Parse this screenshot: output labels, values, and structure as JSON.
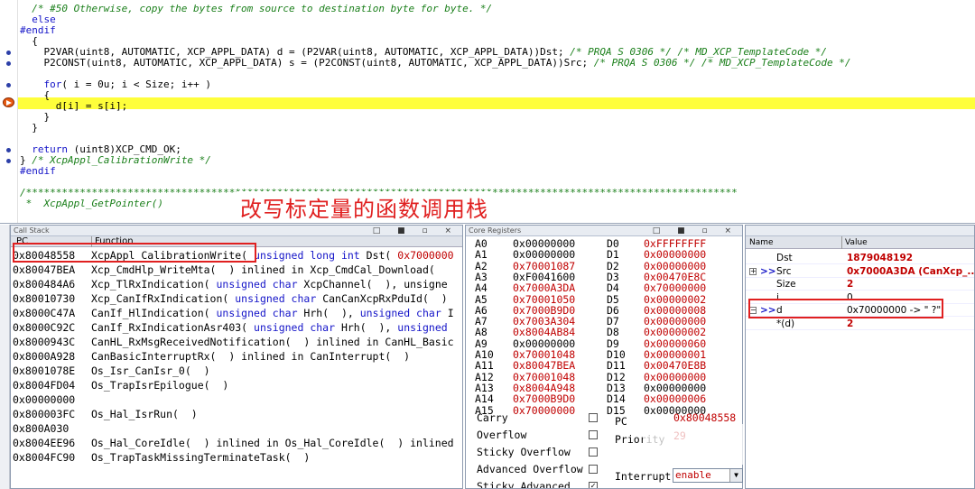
{
  "editor": {
    "lines": [
      {
        "text": "  /* #50 Otherwise, copy the bytes from source to destination byte for byte. */",
        "cls": "cmt"
      },
      {
        "text": "  else",
        "cls": "pp"
      },
      {
        "text": "#endif",
        "cls": "pp"
      },
      {
        "text": "  {",
        "cls": ""
      },
      {
        "text": "    P2VAR(uint8, AUTOMATIC, XCP_APPL_DATA) d = (P2VAR(uint8, AUTOMATIC, XCP_APPL_DATA))Dst; /* PRQA S 0306 */ /* MD_XCP_TemplateCode */",
        "cls": "mixed1"
      },
      {
        "text": "    P2CONST(uint8, AUTOMATIC, XCP_APPL_DATA) s = (P2CONST(uint8, AUTOMATIC, XCP_APPL_DATA))Src; /* PRQA S 0306 */ /* MD_XCP_TemplateCode */",
        "cls": "mixed2"
      },
      {
        "text": "",
        "cls": ""
      },
      {
        "text": "    for( i = 0u; i < Size; i++ )",
        "cls": "for"
      },
      {
        "text": "    {",
        "cls": ""
      },
      {
        "text": "      d[i] = s[i];",
        "cls": ""
      },
      {
        "text": "    }",
        "cls": ""
      },
      {
        "text": "  }",
        "cls": ""
      },
      {
        "text": "",
        "cls": ""
      },
      {
        "text": "  return (uint8)XCP_CMD_OK;",
        "cls": "ret"
      },
      {
        "text": "} /* XcpAppl_CalibrationWrite */",
        "cls": "end"
      },
      {
        "text": "#endif",
        "cls": "pp"
      },
      {
        "text": "",
        "cls": ""
      },
      {
        "text": "/***********************************************************************************************************************",
        "cls": "cmt"
      },
      {
        "text": " *  XcpAppl_GetPointer()",
        "cls": "cmt"
      }
    ],
    "annotation": "改写标定量的函数调用栈"
  },
  "call_stack": {
    "title": "Call Stack",
    "col_pc": "PC",
    "col_function": "Function",
    "rows": [
      {
        "pc": "0x80048558",
        "fn": "XcpAppl_CalibrationWrite( unsigned long int Dst( 0x7000000"
      },
      {
        "pc": "0x80047BEA",
        "fn": "Xcp_CmdHlp_WriteMta(  ) inlined in Xcp_CmdCal_Download("
      },
      {
        "pc": "0x800484A6",
        "fn": "Xcp_TlRxIndication( unsigned char XcpChannel(  ), unsigne"
      },
      {
        "pc": "0x80010730",
        "fn": "Xcp_CanIfRxIndication( unsigned char CanCanXcpRxPduId(  )"
      },
      {
        "pc": "0x8000C47A",
        "fn": "CanIf_HlIndication( unsigned char Hrh(  ), unsigned char I"
      },
      {
        "pc": "0x8000C92C",
        "fn": "CanIf_RxIndicationAsr403( unsigned char Hrh(  ), unsigned"
      },
      {
        "pc": "0x8000943C",
        "fn": "CanHL_RxMsgReceivedNotification(  ) inlined in CanHL_Basic"
      },
      {
        "pc": "0x8000A928",
        "fn": "CanBasicInterruptRx(  ) inlined in CanInterrupt(  )"
      },
      {
        "pc": "0x8001078E",
        "fn": "Os_Isr_CanIsr_0(  )"
      },
      {
        "pc": "0x8004FD04",
        "fn": "Os_TrapIsrEpilogue(  )"
      },
      {
        "pc": "0x00000000",
        "fn": ""
      },
      {
        "pc": "0x800003FC",
        "fn": "Os_Hal_IsrRun(  )"
      },
      {
        "pc": "0x800A030",
        "fn": ""
      },
      {
        "pc": "0x8004EE96",
        "fn": "Os_Hal_CoreIdle(  ) inlined in Os_Hal_CoreIdle(  ) inlined"
      },
      {
        "pc": "0x8004FC90",
        "fn": "Os_TrapTaskMissingTerminateTask(  )"
      }
    ]
  },
  "core_registers": {
    "title": "Core Registers",
    "a_regs": [
      {
        "name": "A0",
        "value": "0x00000000",
        "changed": false
      },
      {
        "name": "A1",
        "value": "0x00000000",
        "changed": false
      },
      {
        "name": "A2",
        "value": "0x70001087",
        "changed": true
      },
      {
        "name": "A3",
        "value": "0xF0041600",
        "changed": false
      },
      {
        "name": "A4",
        "value": "0x7000A3DA",
        "changed": true
      },
      {
        "name": "A5",
        "value": "0x70001050",
        "changed": true
      },
      {
        "name": "A6",
        "value": "0x7000B9D0",
        "changed": true
      },
      {
        "name": "A7",
        "value": "0x7003A304",
        "changed": true
      },
      {
        "name": "A8",
        "value": "0x8004AB84",
        "changed": true
      },
      {
        "name": "A9",
        "value": "0x00000000",
        "changed": false
      },
      {
        "name": "A10",
        "value": "0x70001048",
        "changed": true
      },
      {
        "name": "A11",
        "value": "0x80047BEA",
        "changed": true
      },
      {
        "name": "A12",
        "value": "0x70001048",
        "changed": true
      },
      {
        "name": "A13",
        "value": "0x8004A948",
        "changed": true
      },
      {
        "name": "A14",
        "value": "0x7000B9D0",
        "changed": true
      },
      {
        "name": "A15",
        "value": "0x70000000",
        "changed": true
      }
    ],
    "d_regs": [
      {
        "name": "D0",
        "value": "0xFFFFFFFF",
        "changed": true
      },
      {
        "name": "D1",
        "value": "0x00000000",
        "changed": true
      },
      {
        "name": "D2",
        "value": "0x00000000",
        "changed": true
      },
      {
        "name": "D3",
        "value": "0x00470E8C",
        "changed": true
      },
      {
        "name": "D4",
        "value": "0x70000000",
        "changed": true
      },
      {
        "name": "D5",
        "value": "0x00000002",
        "changed": true
      },
      {
        "name": "D6",
        "value": "0x00000008",
        "changed": true
      },
      {
        "name": "D7",
        "value": "0x00000000",
        "changed": true
      },
      {
        "name": "D8",
        "value": "0x00000002",
        "changed": true
      },
      {
        "name": "D9",
        "value": "0x00000060",
        "changed": true
      },
      {
        "name": "D10",
        "value": "0x00000001",
        "changed": true
      },
      {
        "name": "D11",
        "value": "0x00470E8B",
        "changed": true
      },
      {
        "name": "D12",
        "value": "0x00000000",
        "changed": true
      },
      {
        "name": "D13",
        "value": "0x00000000",
        "changed": false
      },
      {
        "name": "D14",
        "value": "0x00000006",
        "changed": true
      },
      {
        "name": "D15",
        "value": "0x00000000",
        "changed": false
      }
    ],
    "flags": [
      {
        "label": "Carry",
        "checked": false
      },
      {
        "label": "Overflow",
        "checked": false
      },
      {
        "label": "Sticky Overflow",
        "checked": false
      },
      {
        "label": "Advanced Overflow",
        "checked": false
      },
      {
        "label": "Sticky Advanced",
        "checked": true
      }
    ],
    "pc_label": "PC",
    "pc_value": "0x80048558",
    "priority_label": "Priority",
    "priority_value": "29",
    "interrupt_label": "Interrupt",
    "interrupt_value": "enable"
  },
  "watch": {
    "col_name": "Name",
    "col_value": "Value",
    "rows": [
      {
        "name": "Dst",
        "value": "1879048192",
        "red": true,
        "expander": ""
      },
      {
        "name": "Src",
        "value": "0x7000A3DA (CanXcp_...",
        "red": true,
        "expander": "+"
      },
      {
        "name": "Size",
        "value": "2",
        "red": true,
        "expander": ""
      },
      {
        "name": "i",
        "value": "0",
        "red": false,
        "expander": ""
      },
      {
        "name": "d",
        "value": "0x70000000 -> \" ?\"",
        "red": false,
        "expander": "−"
      },
      {
        "name": "*(d)",
        "value": "2",
        "red": true,
        "expander": ""
      }
    ]
  }
}
